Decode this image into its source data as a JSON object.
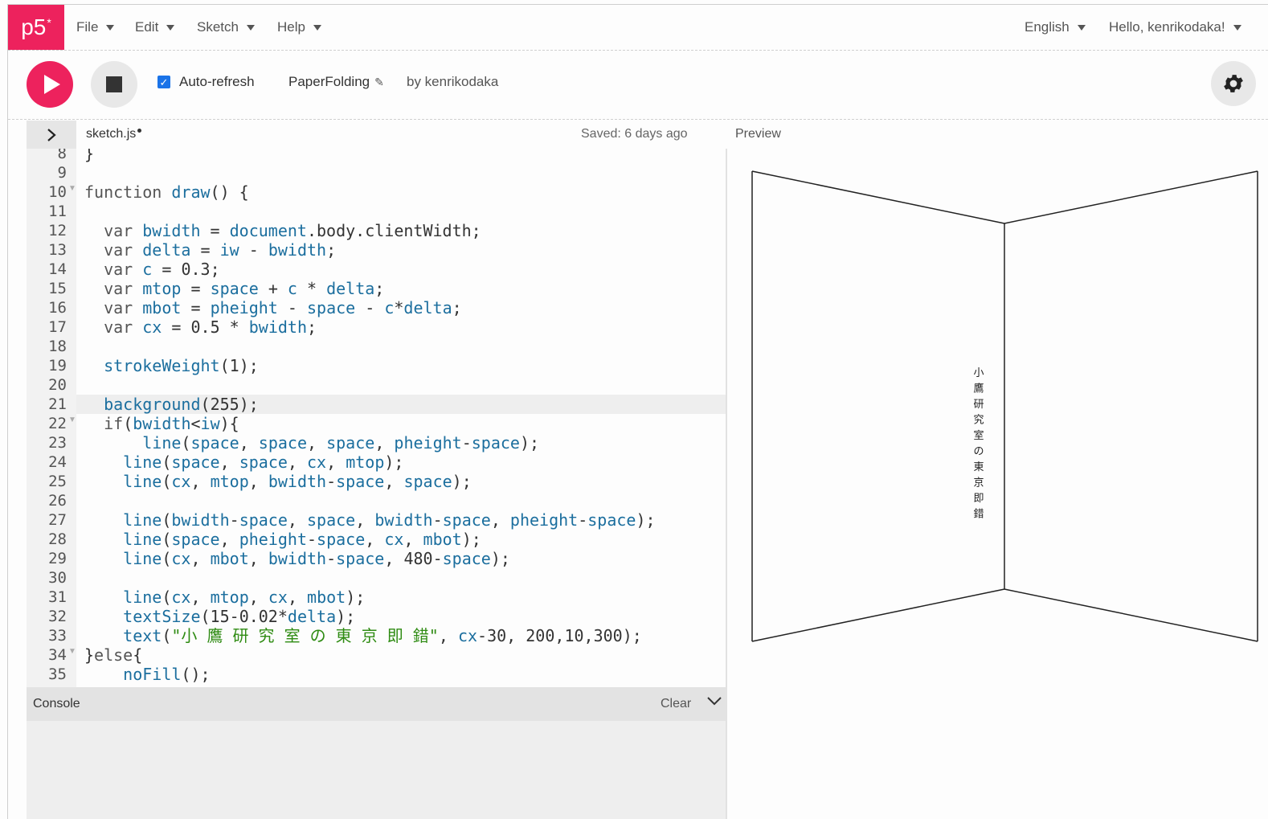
{
  "nav": {
    "logo": "p5",
    "logo_mark": "*",
    "menus": [
      "File",
      "Edit",
      "Sketch",
      "Help"
    ],
    "language": "English",
    "user": "Hello, kenrikodaka!"
  },
  "toolbar": {
    "autorefresh_label": "Auto-refresh",
    "autorefresh_checked": true,
    "project_name": "PaperFolding",
    "author": "by kenrikodaka"
  },
  "editor": {
    "filename": "sketch.js",
    "saved_status": "Saved: 6 days ago",
    "highlighted_line": 21,
    "lines": [
      {
        "n": "8",
        "text": "}"
      },
      {
        "n": "9",
        "text": ""
      },
      {
        "n": "10",
        "text": "function draw() {",
        "fold": true
      },
      {
        "n": "11",
        "text": ""
      },
      {
        "n": "12",
        "text": "  var bwidth = document.body.clientWidth;"
      },
      {
        "n": "13",
        "text": "  var delta = iw - bwidth;"
      },
      {
        "n": "14",
        "text": "  var c = 0.3;"
      },
      {
        "n": "15",
        "text": "  var mtop = space + c * delta;"
      },
      {
        "n": "16",
        "text": "  var mbot = pheight - space - c*delta;"
      },
      {
        "n": "17",
        "text": "  var cx = 0.5 * bwidth;"
      },
      {
        "n": "18",
        "text": ""
      },
      {
        "n": "19",
        "text": "  strokeWeight(1);"
      },
      {
        "n": "20",
        "text": ""
      },
      {
        "n": "21",
        "text": "  background(255);"
      },
      {
        "n": "22",
        "text": "  if(bwidth<iw){",
        "fold": true
      },
      {
        "n": "23",
        "text": "      line(space, space, space, pheight-space);"
      },
      {
        "n": "24",
        "text": "    line(space, space, cx, mtop);"
      },
      {
        "n": "25",
        "text": "    line(cx, mtop, bwidth-space, space);"
      },
      {
        "n": "26",
        "text": ""
      },
      {
        "n": "27",
        "text": "    line(bwidth-space, space, bwidth-space, pheight-space);"
      },
      {
        "n": "28",
        "text": "    line(space, pheight-space, cx, mbot);"
      },
      {
        "n": "29",
        "text": "    line(cx, mbot, bwidth-space, 480-space);"
      },
      {
        "n": "30",
        "text": ""
      },
      {
        "n": "31",
        "text": "    line(cx, mtop, cx, mbot);"
      },
      {
        "n": "32",
        "text": "    textSize(15-0.02*delta);"
      },
      {
        "n": "33",
        "text": "    text(\"小 鷹 研 究 室 の 東 京 即 錯\", cx-30, 200,10,300);"
      },
      {
        "n": "34",
        "text": "}else{",
        "fold": true
      },
      {
        "n": "35",
        "text": "    noFill();"
      }
    ]
  },
  "console": {
    "title": "Console",
    "clear_label": "Clear"
  },
  "preview": {
    "label": "Preview",
    "vertical_text": "小鷹研究室の東京即錯"
  }
}
